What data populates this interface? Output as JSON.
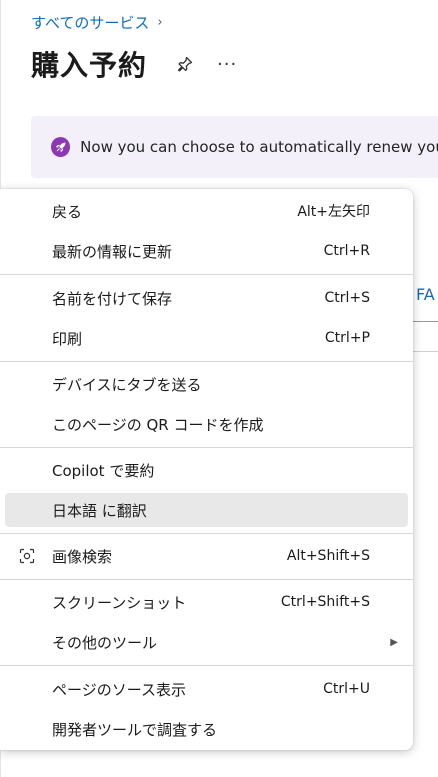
{
  "breadcrumb": {
    "link": "すべてのサービス",
    "chevron": "›"
  },
  "header": {
    "title": "購入予約",
    "more": "···"
  },
  "banner": {
    "text": "Now you can choose to automatically renew your",
    "icon": "rocket-icon"
  },
  "background": {
    "fa_text": "FA"
  },
  "context_menu": {
    "items": [
      {
        "label": "戻る",
        "shortcut": "Alt+左矢印"
      },
      {
        "label": "最新の情報に更新",
        "shortcut": "Ctrl+R"
      },
      {
        "label": "名前を付けて保存",
        "shortcut": "Ctrl+S"
      },
      {
        "label": "印刷",
        "shortcut": "Ctrl+P"
      },
      {
        "label": "デバイスにタブを送る",
        "shortcut": ""
      },
      {
        "label": "このページの QR コードを作成",
        "shortcut": ""
      },
      {
        "label": "Copilot で要約",
        "shortcut": ""
      },
      {
        "label": "日本語 に翻訳",
        "shortcut": ""
      },
      {
        "label": "画像検索",
        "shortcut": "Alt+Shift+S"
      },
      {
        "label": "スクリーンショット",
        "shortcut": "Ctrl+Shift+S"
      },
      {
        "label": "その他のツール",
        "shortcut": ""
      },
      {
        "label": "ページのソース表示",
        "shortcut": "Ctrl+U"
      },
      {
        "label": "開発者ツールで調査する",
        "shortcut": ""
      }
    ]
  },
  "colors": {
    "link": "#0f6cbd",
    "banner_bg": "#f4f0fa",
    "banner_icon": "#8c37b3",
    "highlight": "#e8e8e8"
  }
}
